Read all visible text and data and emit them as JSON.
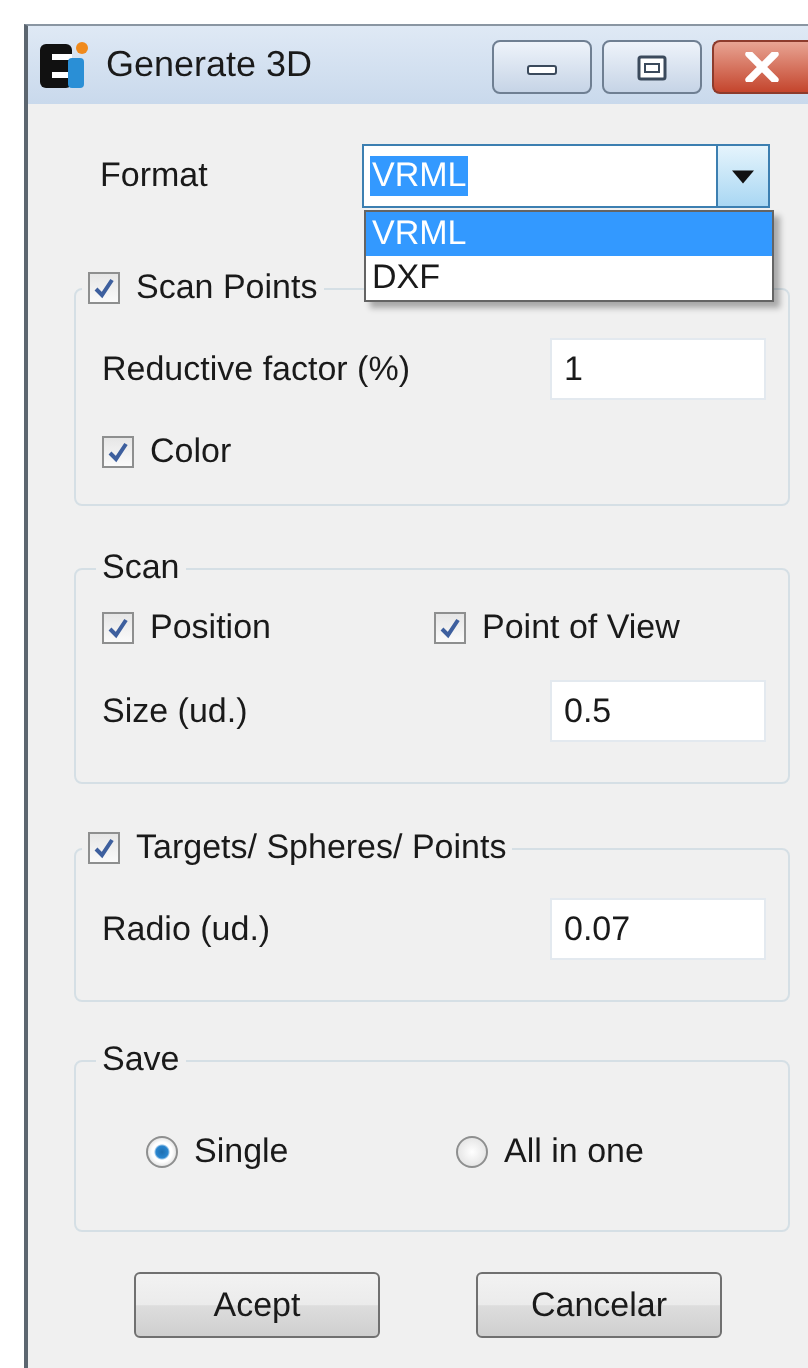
{
  "window": {
    "title": "Generate 3D"
  },
  "format": {
    "label": "Format",
    "value": "VRML",
    "expanded": true,
    "options": [
      {
        "label": "VRML",
        "selected": true
      },
      {
        "label": "DXF",
        "selected": false
      }
    ]
  },
  "groups": [
    {
      "kind": "checkable",
      "title": "Scan Points",
      "checked": true,
      "rows": [
        {
          "kind": "field",
          "label": "Reductive factor (%)",
          "value": "1"
        },
        {
          "kind": "checks",
          "items": [
            {
              "label": "Color",
              "checked": true
            }
          ]
        }
      ]
    },
    {
      "kind": "plain",
      "title": "Scan",
      "rows": [
        {
          "kind": "checks",
          "items": [
            {
              "label": "Position",
              "checked": true
            },
            {
              "label": "Point of View",
              "checked": true
            }
          ]
        },
        {
          "kind": "field",
          "label": "Size (ud.)",
          "value": "0.5"
        }
      ]
    },
    {
      "kind": "checkable",
      "title": "Targets/ Spheres/ Points",
      "checked": true,
      "rows": [
        {
          "kind": "field",
          "label": "Radio (ud.)",
          "value": "0.07"
        }
      ]
    },
    {
      "kind": "plain",
      "title": "Save",
      "rows": [
        {
          "kind": "radios",
          "items": [
            {
              "label": "Single",
              "selected": true
            },
            {
              "label": "All in one",
              "selected": false
            }
          ]
        }
      ]
    }
  ],
  "buttons": [
    "Acept",
    "Cancelar"
  ]
}
